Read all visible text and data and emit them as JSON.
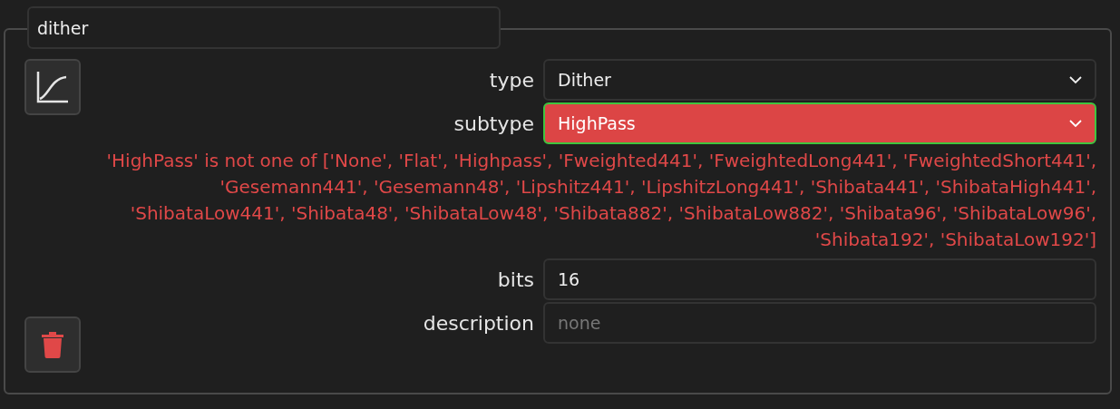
{
  "name_field": {
    "value": "dither"
  },
  "fields": [
    {
      "kind": "select",
      "label": "type",
      "value": "Dither",
      "invalid": false,
      "focused": false
    },
    {
      "kind": "select",
      "label": "subtype",
      "value": "HighPass",
      "invalid": true,
      "focused": true,
      "error": "'HighPass' is not one of ['None', 'Flat', 'Highpass', 'Fweighted441', 'FweightedLong441', 'FweightedShort441', 'Gesemann441', 'Gesemann48', 'Lipshitz441', 'LipshitzLong441', 'Shibata441', 'ShibataHigh441', 'ShibataLow441', 'Shibata48', 'ShibataLow48', 'Shibata882', 'ShibataLow882', 'Shibata96', 'ShibataLow96', 'Shibata192', 'ShibataLow192']"
    },
    {
      "kind": "text",
      "label": "bits",
      "value": "16",
      "invalid": false,
      "focused": false
    },
    {
      "kind": "text",
      "label": "description",
      "placeholder": "none",
      "invalid": false,
      "focused": false
    }
  ]
}
